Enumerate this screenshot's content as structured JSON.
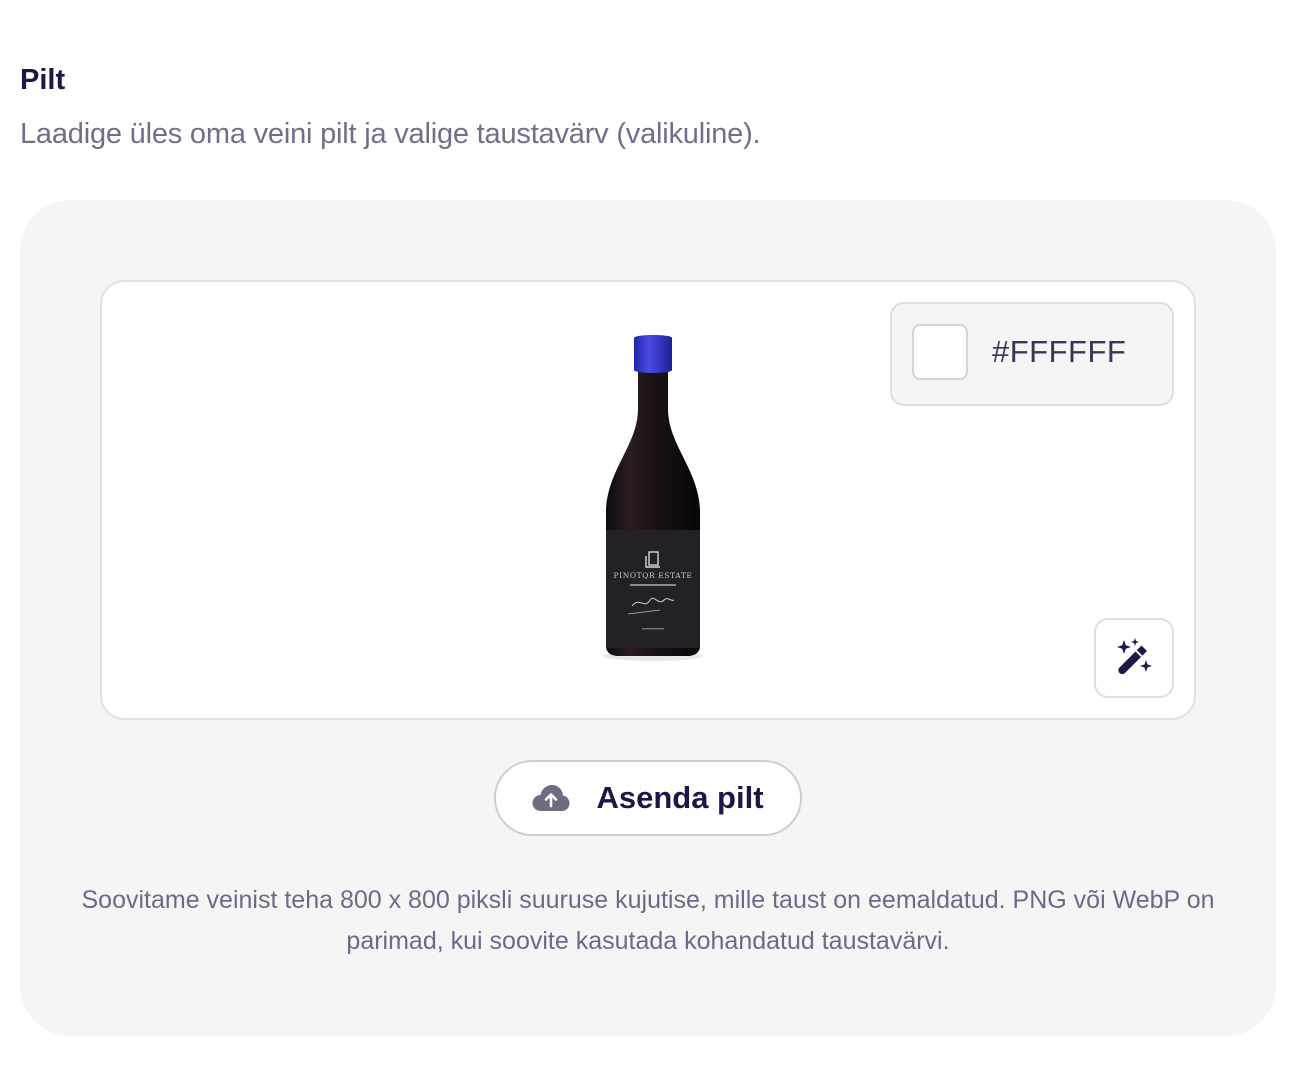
{
  "section": {
    "title": "Pilt",
    "description": "Laadige üles oma veini pilt ja valige taustavärv (valikuline)."
  },
  "preview": {
    "background_color": "#FFFFFF",
    "hex_label": "#FFFFFF",
    "bottle_icon": "wine-bottle-image",
    "bottle_label_brand": "PINOTQR ESTATE",
    "magic_icon": "magic-wand-icon"
  },
  "upload": {
    "button_label": "Asenda pilt",
    "button_icon": "cloud-upload-icon"
  },
  "hint": "Soovitame veinist teha 800 x 800 piksli suuruse kujutise, mille taust on eemaldatud. PNG või WebP on parimad, kui soovite kasutada kohandatud taustavärvi.",
  "colors": {
    "accent": "#1b1848",
    "capsule": "#3b3cd0",
    "panel_bg": "#f5f5f6"
  }
}
